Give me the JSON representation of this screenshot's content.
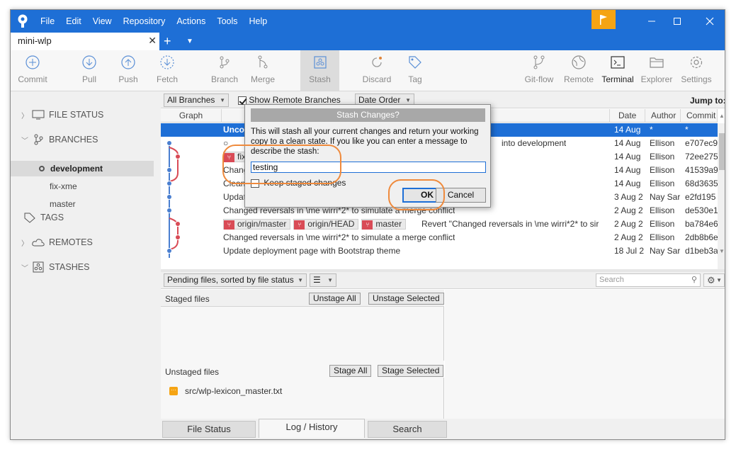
{
  "app": {
    "menu": [
      "File",
      "Edit",
      "View",
      "Repository",
      "Actions",
      "Tools",
      "Help"
    ],
    "tab_name": "mini-wlp"
  },
  "toolbar": {
    "commit": "Commit",
    "pull": "Pull",
    "push": "Push",
    "fetch": "Fetch",
    "branch": "Branch",
    "merge": "Merge",
    "stash": "Stash",
    "discard": "Discard",
    "tag": "Tag",
    "gitflow": "Git-flow",
    "remote": "Remote",
    "terminal": "Terminal",
    "explorer": "Explorer",
    "settings": "Settings"
  },
  "sidebar": {
    "file_status": "FILE STATUS",
    "branches": "BRANCHES",
    "branch_items": [
      "development",
      "fix-xme",
      "master"
    ],
    "tags": "TAGS",
    "remotes": "REMOTES",
    "stashes": "STASHES"
  },
  "log": {
    "branch_filter": "All Branches",
    "show_remote": "Show Remote Branches",
    "order": "Date Order",
    "jump_to": "Jump to:",
    "col_graph": "Graph",
    "col_date": "Date",
    "col_author": "Author",
    "col_commit": "Commit",
    "rows": [
      {
        "desc": "Unco",
        "date": "14 Aug",
        "author": "*",
        "commit": "*"
      },
      {
        "desc": "into development",
        "date": "14 Aug",
        "author": "Ellison",
        "commit": "e707ec9"
      },
      {
        "desc": "fix",
        "date": "14 Aug",
        "author": "Ellison",
        "commit": "72ee275"
      },
      {
        "desc": "Chang",
        "date": "14 Aug",
        "author": "Ellison",
        "commit": "41539a9"
      },
      {
        "desc": "Clean",
        "date": "14 Aug",
        "author": "Ellison",
        "commit": "68d3635"
      },
      {
        "desc": "Updat",
        "date": "3 Aug 2",
        "author": "Nay Sar",
        "commit": "e2fd195"
      },
      {
        "desc": "Changed reversals in \\me wirri*2* to simulate a merge conflict",
        "date": "2 Aug 2",
        "author": "Ellison",
        "commit": "de530e1"
      },
      {
        "desc": "Revert \"Changed reversals in \\me wirri*2* to sir",
        "date": "2 Aug 2",
        "author": "Ellison",
        "commit": "ba784e6"
      },
      {
        "desc": "Changed reversals in \\me wirri*2* to simulate a merge conflict",
        "date": "2 Aug 2",
        "author": "Ellison",
        "commit": "2db8b6e"
      },
      {
        "desc": "Update deployment page with Bootstrap theme",
        "date": "18 Jul 2",
        "author": "Nay Sar",
        "commit": "d1beb3a"
      }
    ],
    "labels": [
      "origin/master",
      "origin/HEAD",
      "master"
    ]
  },
  "pending": {
    "sort": "Pending files, sorted by file status",
    "search_placeholder": "Search",
    "staged_title": "Staged files",
    "unstage_all": "Unstage All",
    "unstage_selected": "Unstage Selected",
    "unstaged_title": "Unstaged files",
    "stage_all": "Stage All",
    "stage_selected": "Stage Selected",
    "unstaged_files": [
      "src/wlp-lexicon_master.txt"
    ]
  },
  "bottom_tabs": [
    "File Status",
    "Log / History",
    "Search"
  ],
  "dialog": {
    "title": "Stash Changes?",
    "message": "This will stash all your current changes and return your working copy to a clean state. If you like you can enter a message to describe the stash:",
    "input_value": "testing",
    "keep_staged": "Keep staged changes",
    "ok": "OK",
    "cancel": "Cancel"
  },
  "colors": {
    "accent": "#1e6fd6",
    "highlight": "#ef8a3c",
    "label_red": "#d94b56",
    "flag": "#f5a414"
  }
}
